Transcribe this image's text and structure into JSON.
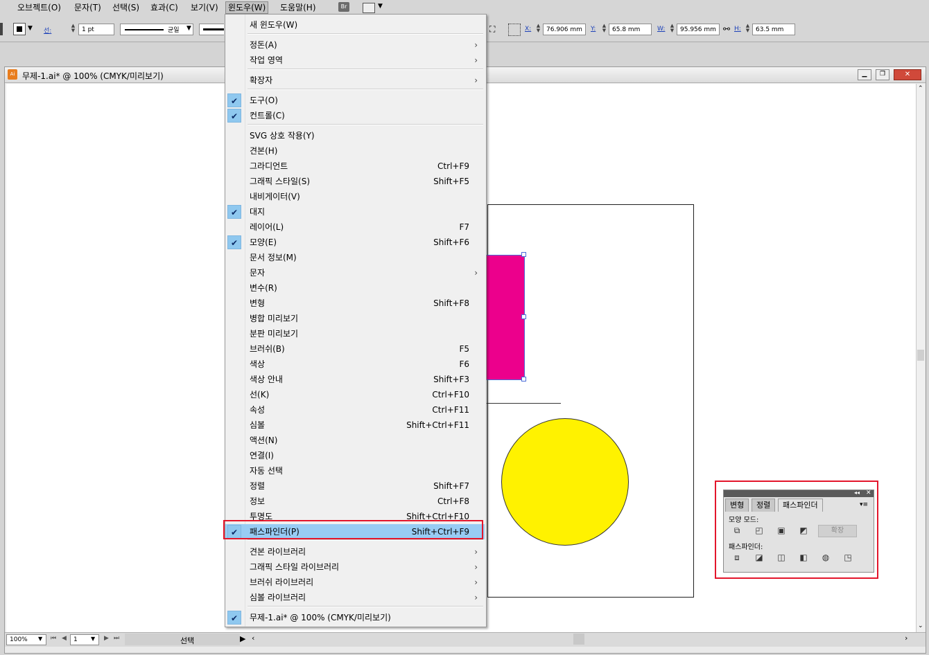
{
  "menubar": {
    "items": [
      "오브젝트(O)",
      "문자(T)",
      "선택(S)",
      "효과(C)",
      "보기(V)",
      "윈도우(W)",
      "도움말(H)"
    ],
    "bridge_label": "Br"
  },
  "control": {
    "stroke_label": "선:",
    "stroke_weight": "1 pt",
    "profile_label": "균일",
    "x_label": "X:",
    "x_value": "76.906 mm",
    "y_label": "Y:",
    "y_value": "65.8 mm",
    "w_label": "W:",
    "w_value": "95.956 mm",
    "h_label": "H:",
    "h_value": "63.5 mm"
  },
  "document": {
    "title": "무제-1.ai* @ 100% (CMYK/미리보기)",
    "zoom": "100%",
    "page": "1",
    "status_tool": "선택"
  },
  "window_menu": {
    "items": [
      {
        "label": "새 윈도우(W)"
      },
      {
        "label": "정돈(A)",
        "submenu": true
      },
      {
        "label": "작업 영역",
        "submenu": true
      },
      {
        "label": "확장자",
        "submenu": true
      },
      {
        "label": "도구(O)",
        "checked": true
      },
      {
        "label": "컨트롤(C)",
        "checked": true
      },
      {
        "label": "SVG 상호 작용(Y)"
      },
      {
        "label": "견본(H)"
      },
      {
        "label": "그라디언트",
        "shortcut": "Ctrl+F9"
      },
      {
        "label": "그래픽 스타일(S)",
        "shortcut": "Shift+F5"
      },
      {
        "label": "내비게이터(V)"
      },
      {
        "label": "대지",
        "checked": true
      },
      {
        "label": "레이어(L)",
        "shortcut": "F7"
      },
      {
        "label": "모양(E)",
        "shortcut": "Shift+F6",
        "checked": true
      },
      {
        "label": "문서 정보(M)"
      },
      {
        "label": "문자",
        "submenu": true
      },
      {
        "label": "변수(R)"
      },
      {
        "label": "변형",
        "shortcut": "Shift+F8"
      },
      {
        "label": "병합 미리보기"
      },
      {
        "label": "분판 미리보기"
      },
      {
        "label": "브러쉬(B)",
        "shortcut": "F5"
      },
      {
        "label": "색상",
        "shortcut": "F6"
      },
      {
        "label": "색상 안내",
        "shortcut": "Shift+F3"
      },
      {
        "label": "선(K)",
        "shortcut": "Ctrl+F10"
      },
      {
        "label": "속성",
        "shortcut": "Ctrl+F11"
      },
      {
        "label": "심볼",
        "shortcut": "Shift+Ctrl+F11"
      },
      {
        "label": "액션(N)"
      },
      {
        "label": "연결(I)"
      },
      {
        "label": "자동 선택"
      },
      {
        "label": "정렬",
        "shortcut": "Shift+F7"
      },
      {
        "label": "정보",
        "shortcut": "Ctrl+F8"
      },
      {
        "label": "투명도",
        "shortcut": "Shift+Ctrl+F10"
      },
      {
        "label": "패스파인더(P)",
        "shortcut": "Shift+Ctrl+F9",
        "checked": true,
        "highlighted": true
      },
      {
        "label": "견본 라이브러리",
        "submenu": true
      },
      {
        "label": "그래픽 스타일 라이브러리",
        "submenu": true
      },
      {
        "label": "브러쉬 라이브러리",
        "submenu": true
      },
      {
        "label": "심볼 라이브러리",
        "submenu": true
      },
      {
        "label": "무제-1.ai* @ 100% (CMYK/미리보기)",
        "checked": true
      }
    ]
  },
  "pathfinder_panel": {
    "tabs": [
      "변형",
      "정렬",
      "패스파인더"
    ],
    "active_tab": "패스파인더",
    "shape_modes_label": "모양 모드:",
    "expand_label": "확장",
    "pathfinders_label": "패스파인더:"
  },
  "colors": {
    "magenta_rect": "#ec008c",
    "yellow_circle": "#fff200",
    "highlight": "#e3152b"
  }
}
